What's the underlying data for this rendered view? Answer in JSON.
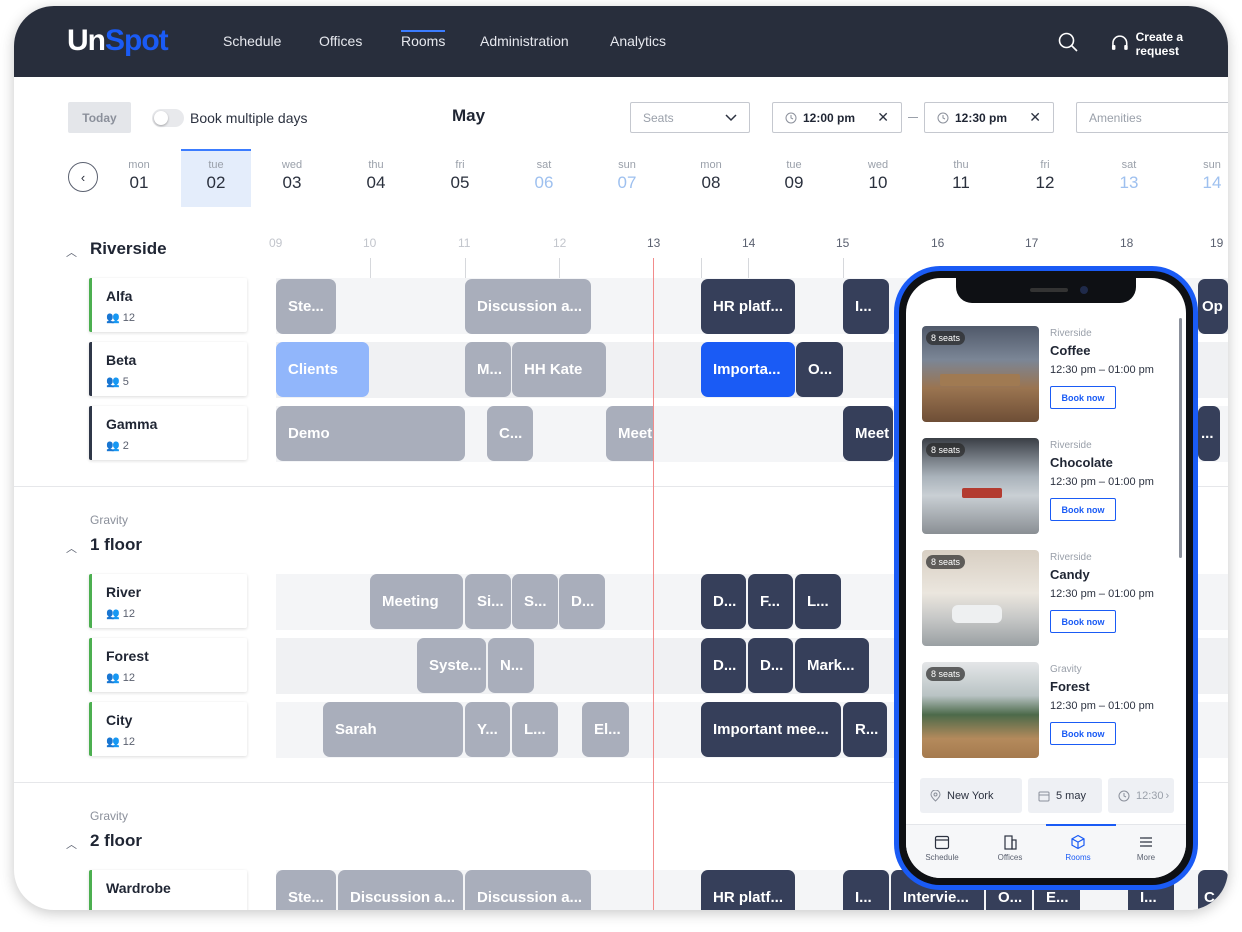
{
  "app": {
    "logo_a": "Un",
    "logo_b": "Spot"
  },
  "nav": [
    "Schedule",
    "Offices",
    "Rooms",
    "Administration",
    "Analytics"
  ],
  "header_action": "Create a request",
  "toolbar": {
    "today": "Today",
    "multi_days": "Book multiple days",
    "month": "May",
    "seats_placeholder": "Seats",
    "time_from": "12:00 pm",
    "time_to": "12:30 pm",
    "amenities_placeholder": "Amenities"
  },
  "days": [
    {
      "w": "mon",
      "n": "01"
    },
    {
      "w": "tue",
      "n": "02"
    },
    {
      "w": "wed",
      "n": "03"
    },
    {
      "w": "thu",
      "n": "04"
    },
    {
      "w": "fri",
      "n": "05"
    },
    {
      "w": "sat",
      "n": "06"
    },
    {
      "w": "sun",
      "n": "07"
    },
    {
      "w": "mon",
      "n": "08"
    },
    {
      "w": "tue",
      "n": "09"
    },
    {
      "w": "wed",
      "n": "10"
    },
    {
      "w": "thu",
      "n": "11"
    },
    {
      "w": "fri",
      "n": "12"
    },
    {
      "w": "sat",
      "n": "13"
    },
    {
      "w": "sun",
      "n": "14"
    }
  ],
  "hours": [
    "09",
    "10",
    "11",
    "12",
    "13",
    "14",
    "15",
    "16",
    "17",
    "18",
    "19"
  ],
  "groups": [
    {
      "sub": "",
      "title": "Riverside"
    },
    {
      "sub": "Gravity",
      "title": "1 floor"
    },
    {
      "sub": "Gravity",
      "title": "2 floor"
    }
  ],
  "rooms": [
    {
      "name": "Alfa",
      "cap": "12"
    },
    {
      "name": "Beta",
      "cap": "5"
    },
    {
      "name": "Gamma",
      "cap": "2"
    },
    {
      "name": "River",
      "cap": "12"
    },
    {
      "name": "Forest",
      "cap": "12"
    },
    {
      "name": "City",
      "cap": "12"
    },
    {
      "name": "Wardrobe",
      "cap": ""
    }
  ],
  "events": {
    "alfa": [
      "Ste...",
      "Discussion a...",
      "HR platf...",
      "I...",
      "Op"
    ],
    "beta": [
      "Clients",
      "M...",
      "HH Kate",
      "Importa...",
      "O..."
    ],
    "gamma": [
      "Demo",
      "C...",
      "Meet",
      "Meet",
      "..."
    ],
    "river": [
      "Meeting",
      "Si...",
      "S...",
      "D...",
      "D...",
      "F...",
      "L..."
    ],
    "forest": [
      "Syste...",
      "N...",
      "D...",
      "D...",
      "Mark..."
    ],
    "city": [
      "Sarah",
      "Y...",
      "L...",
      "El...",
      "Important mee...",
      "R..."
    ],
    "wardrobe": [
      "Ste...",
      "Discussion a...",
      "Discussion a...",
      "HR platf...",
      "I...",
      "Intervie...",
      "O...",
      "E...",
      "I...",
      "C"
    ]
  },
  "mobile": {
    "cards": [
      {
        "seats": "8 seats",
        "loc": "Riverside",
        "name": "Coffee",
        "time": "12:30 pm – 01:00 pm",
        "book": "Book now"
      },
      {
        "seats": "8 seats",
        "loc": "Riverside",
        "name": "Chocolate",
        "time": "12:30 pm – 01:00 pm",
        "book": "Book now"
      },
      {
        "seats": "8 seats",
        "loc": "Riverside",
        "name": "Candy",
        "time": "12:30 pm – 01:00 pm",
        "book": "Book now"
      },
      {
        "seats": "8 seats",
        "loc": "Gravity",
        "name": "Forest",
        "time": "12:30 pm – 01:00 pm",
        "book": "Book now"
      }
    ],
    "chips": {
      "city": "New York",
      "date": "5 may",
      "time": "12:30"
    },
    "tabs": [
      "Schedule",
      "Offices",
      "Rooms",
      "More"
    ]
  },
  "colors": {
    "brand": "#1a5bf5",
    "header_bg": "#282e3c",
    "event_gray": "#a9aebb",
    "event_navy": "#363f5a",
    "now_line": "#f28b8b"
  }
}
